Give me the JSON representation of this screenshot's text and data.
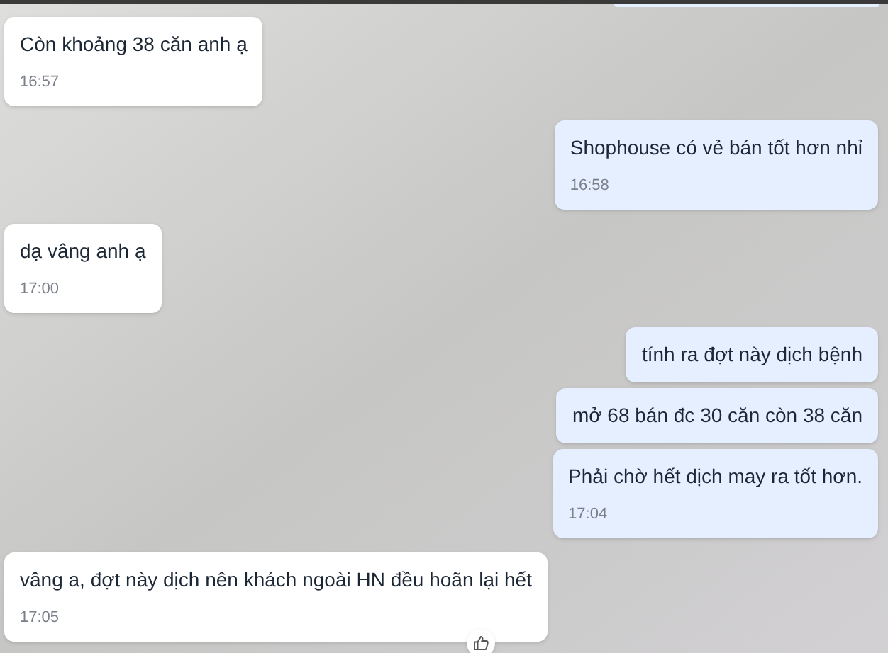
{
  "messages": [
    {
      "kind": "incoming",
      "text": "Còn khoảng 38 căn anh ạ",
      "time": "16:57"
    },
    {
      "kind": "outgoing",
      "text": "Shophouse có vẻ bán tốt hơn nhỉ",
      "time": "16:58"
    },
    {
      "kind": "incoming",
      "text": "dạ vâng anh ạ",
      "time": "17:00"
    },
    {
      "kind": "outgoing",
      "text": "tính ra đợt này dịch bệnh"
    },
    {
      "kind": "outgoing",
      "text": "mở 68 bán đc 30 căn còn 38 căn"
    },
    {
      "kind": "outgoing",
      "text": "Phải chờ hết dịch may ra tốt hơn.",
      "time": "17:04"
    },
    {
      "kind": "incoming",
      "text": "vâng a, đợt này dịch nên khách ngoài HN đều hoãn lại hết",
      "time": "17:05"
    }
  ]
}
